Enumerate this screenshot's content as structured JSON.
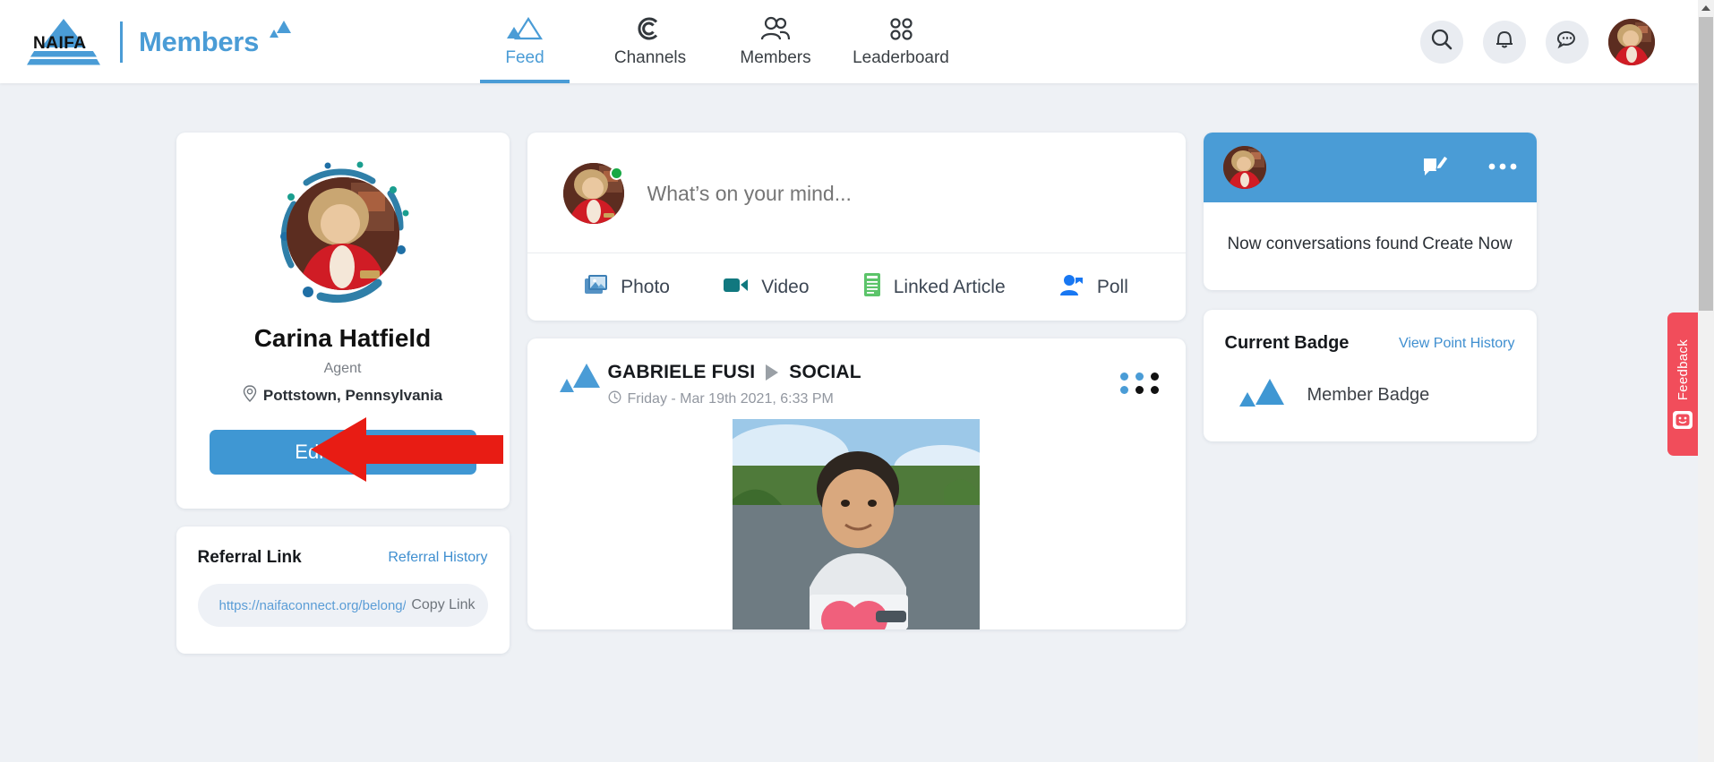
{
  "brand": {
    "logo_text": "NAIFA",
    "product": "Members",
    "logo_icon": "naifa-pyramid-icon"
  },
  "nav": {
    "items": [
      {
        "label": "Feed",
        "icon": "triangles-icon",
        "active": true
      },
      {
        "label": "Channels",
        "icon": "c-circle-icon",
        "active": false
      },
      {
        "label": "Members",
        "icon": "people-icon",
        "active": false
      },
      {
        "label": "Leaderboard",
        "icon": "four-dots-icon",
        "active": false
      }
    ]
  },
  "topbar_actions": {
    "search_icon": "search-icon",
    "notifications_icon": "bell-icon",
    "messages_icon": "chat-bubble-icon",
    "avatar": "user-avatar"
  },
  "profile": {
    "name": "Carina Hatfield",
    "role": "Agent",
    "location": "Pottstown, Pennsylvania",
    "location_icon": "map-pin-icon",
    "edit_button": "Edit Profile"
  },
  "referral": {
    "title": "Referral Link",
    "history_link": "Referral History",
    "url": "https://naifaconnect.org/belong/car",
    "copy_label": "Copy Link"
  },
  "composer": {
    "placeholder": "What’s on your mind...",
    "value": "",
    "actions": [
      {
        "label": "Photo",
        "icon": "photo-icon",
        "color": "#4a90c9"
      },
      {
        "label": "Video",
        "icon": "video-camera-icon",
        "color": "#127d84"
      },
      {
        "label": "Linked Article",
        "icon": "article-icon",
        "color": "#5cc46a"
      },
      {
        "label": "Poll",
        "icon": "poll-person-icon",
        "color": "#1877f2"
      }
    ]
  },
  "post": {
    "author": "GABRIELE FUSI",
    "channel": "SOCIAL",
    "separator_icon": "play-arrow-icon",
    "timestamp": "Friday - Mar 19th 2021, 6:33 PM",
    "time_icon": "clock-icon",
    "menu_icon": "six-dots-menu-icon",
    "badge_icon": "naifa-triangles-icon"
  },
  "conversations": {
    "edit_icon": "compose-pencil-icon",
    "more_icon": "ellipsis-icon",
    "empty_text": "Now conversations found",
    "create_link": "Create Now",
    "header_color": "#4a9cd6"
  },
  "badge": {
    "title": "Current Badge",
    "history_link": "View Point History",
    "name": "Member Badge",
    "icon": "naifa-triangles-icon"
  },
  "feedback": {
    "label": "Feedback",
    "icon": "smiley-feedback-icon",
    "color": "#f14d5b"
  },
  "annotation": {
    "type": "red-arrow",
    "points_to": "Edit Profile",
    "color": "#e81c14"
  },
  "scrollbar": {
    "up_arrow_icon": "scroll-up-arrow-icon"
  },
  "colors": {
    "accent": "#4a9cd6",
    "primary_button": "#3f97d3",
    "page_background": "#eef1f5",
    "online": "#18a844"
  }
}
